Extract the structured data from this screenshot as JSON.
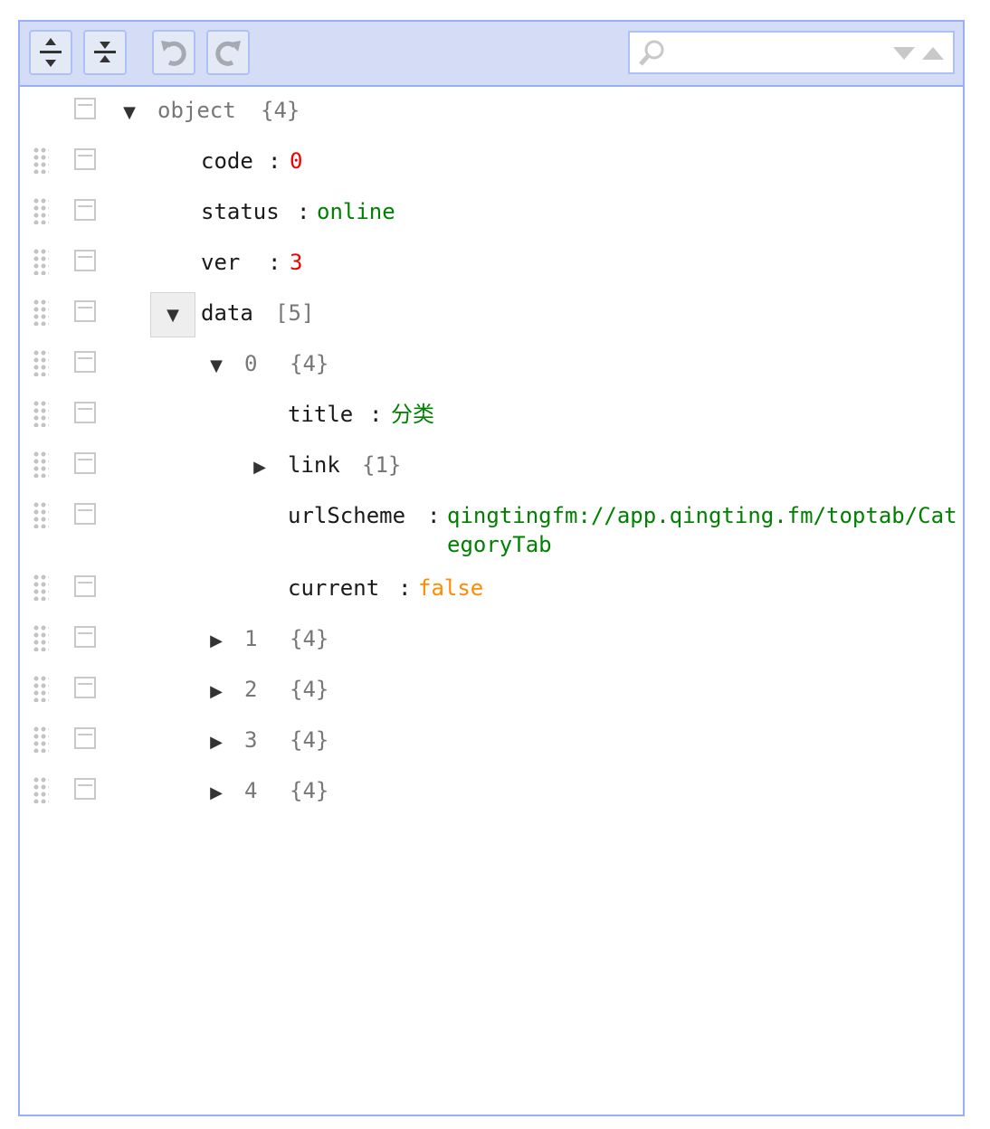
{
  "toolbar": {
    "expand_all_icon": "expand-all-icon",
    "collapse_all_icon": "collapse-all-icon",
    "undo_icon": "undo-icon",
    "redo_icon": "redo-icon",
    "search_placeholder": "",
    "search_value": ""
  },
  "tree": {
    "root": {
      "toggle": "▼",
      "label": "object",
      "count": "{4}"
    },
    "code": {
      "field": "code",
      "sep": ":",
      "value": "0"
    },
    "status": {
      "field": "status",
      "sep": ":",
      "value": "online"
    },
    "ver": {
      "field": "ver",
      "sep": ":",
      "value": "3"
    },
    "data": {
      "toggle": "▼",
      "field": "data",
      "count": "[5]"
    },
    "item0": {
      "toggle": "▼",
      "index": "0",
      "count": "{4}"
    },
    "title": {
      "field": "title",
      "sep": ":",
      "value": "分类"
    },
    "link": {
      "toggle": "▶",
      "field": "link",
      "count": "{1}"
    },
    "urlScheme": {
      "field": "urlScheme",
      "sep": ":",
      "value": "qingtingfm://app.qingting.fm/toptab/CategoryTab"
    },
    "current": {
      "field": "current",
      "sep": ":",
      "value": "false"
    },
    "item1": {
      "toggle": "▶",
      "index": "1",
      "count": "{4}"
    },
    "item2": {
      "toggle": "▶",
      "index": "2",
      "count": "{4}"
    },
    "item3": {
      "toggle": "▶",
      "index": "3",
      "count": "{4}"
    },
    "item4": {
      "toggle": "▶",
      "index": "4",
      "count": "{4}"
    }
  },
  "colors": {
    "menu_bg": "#d5ddf6",
    "border": "#97b0f8",
    "number": "#ee0000",
    "string": "#008000",
    "boolean": "#ff8c00"
  }
}
